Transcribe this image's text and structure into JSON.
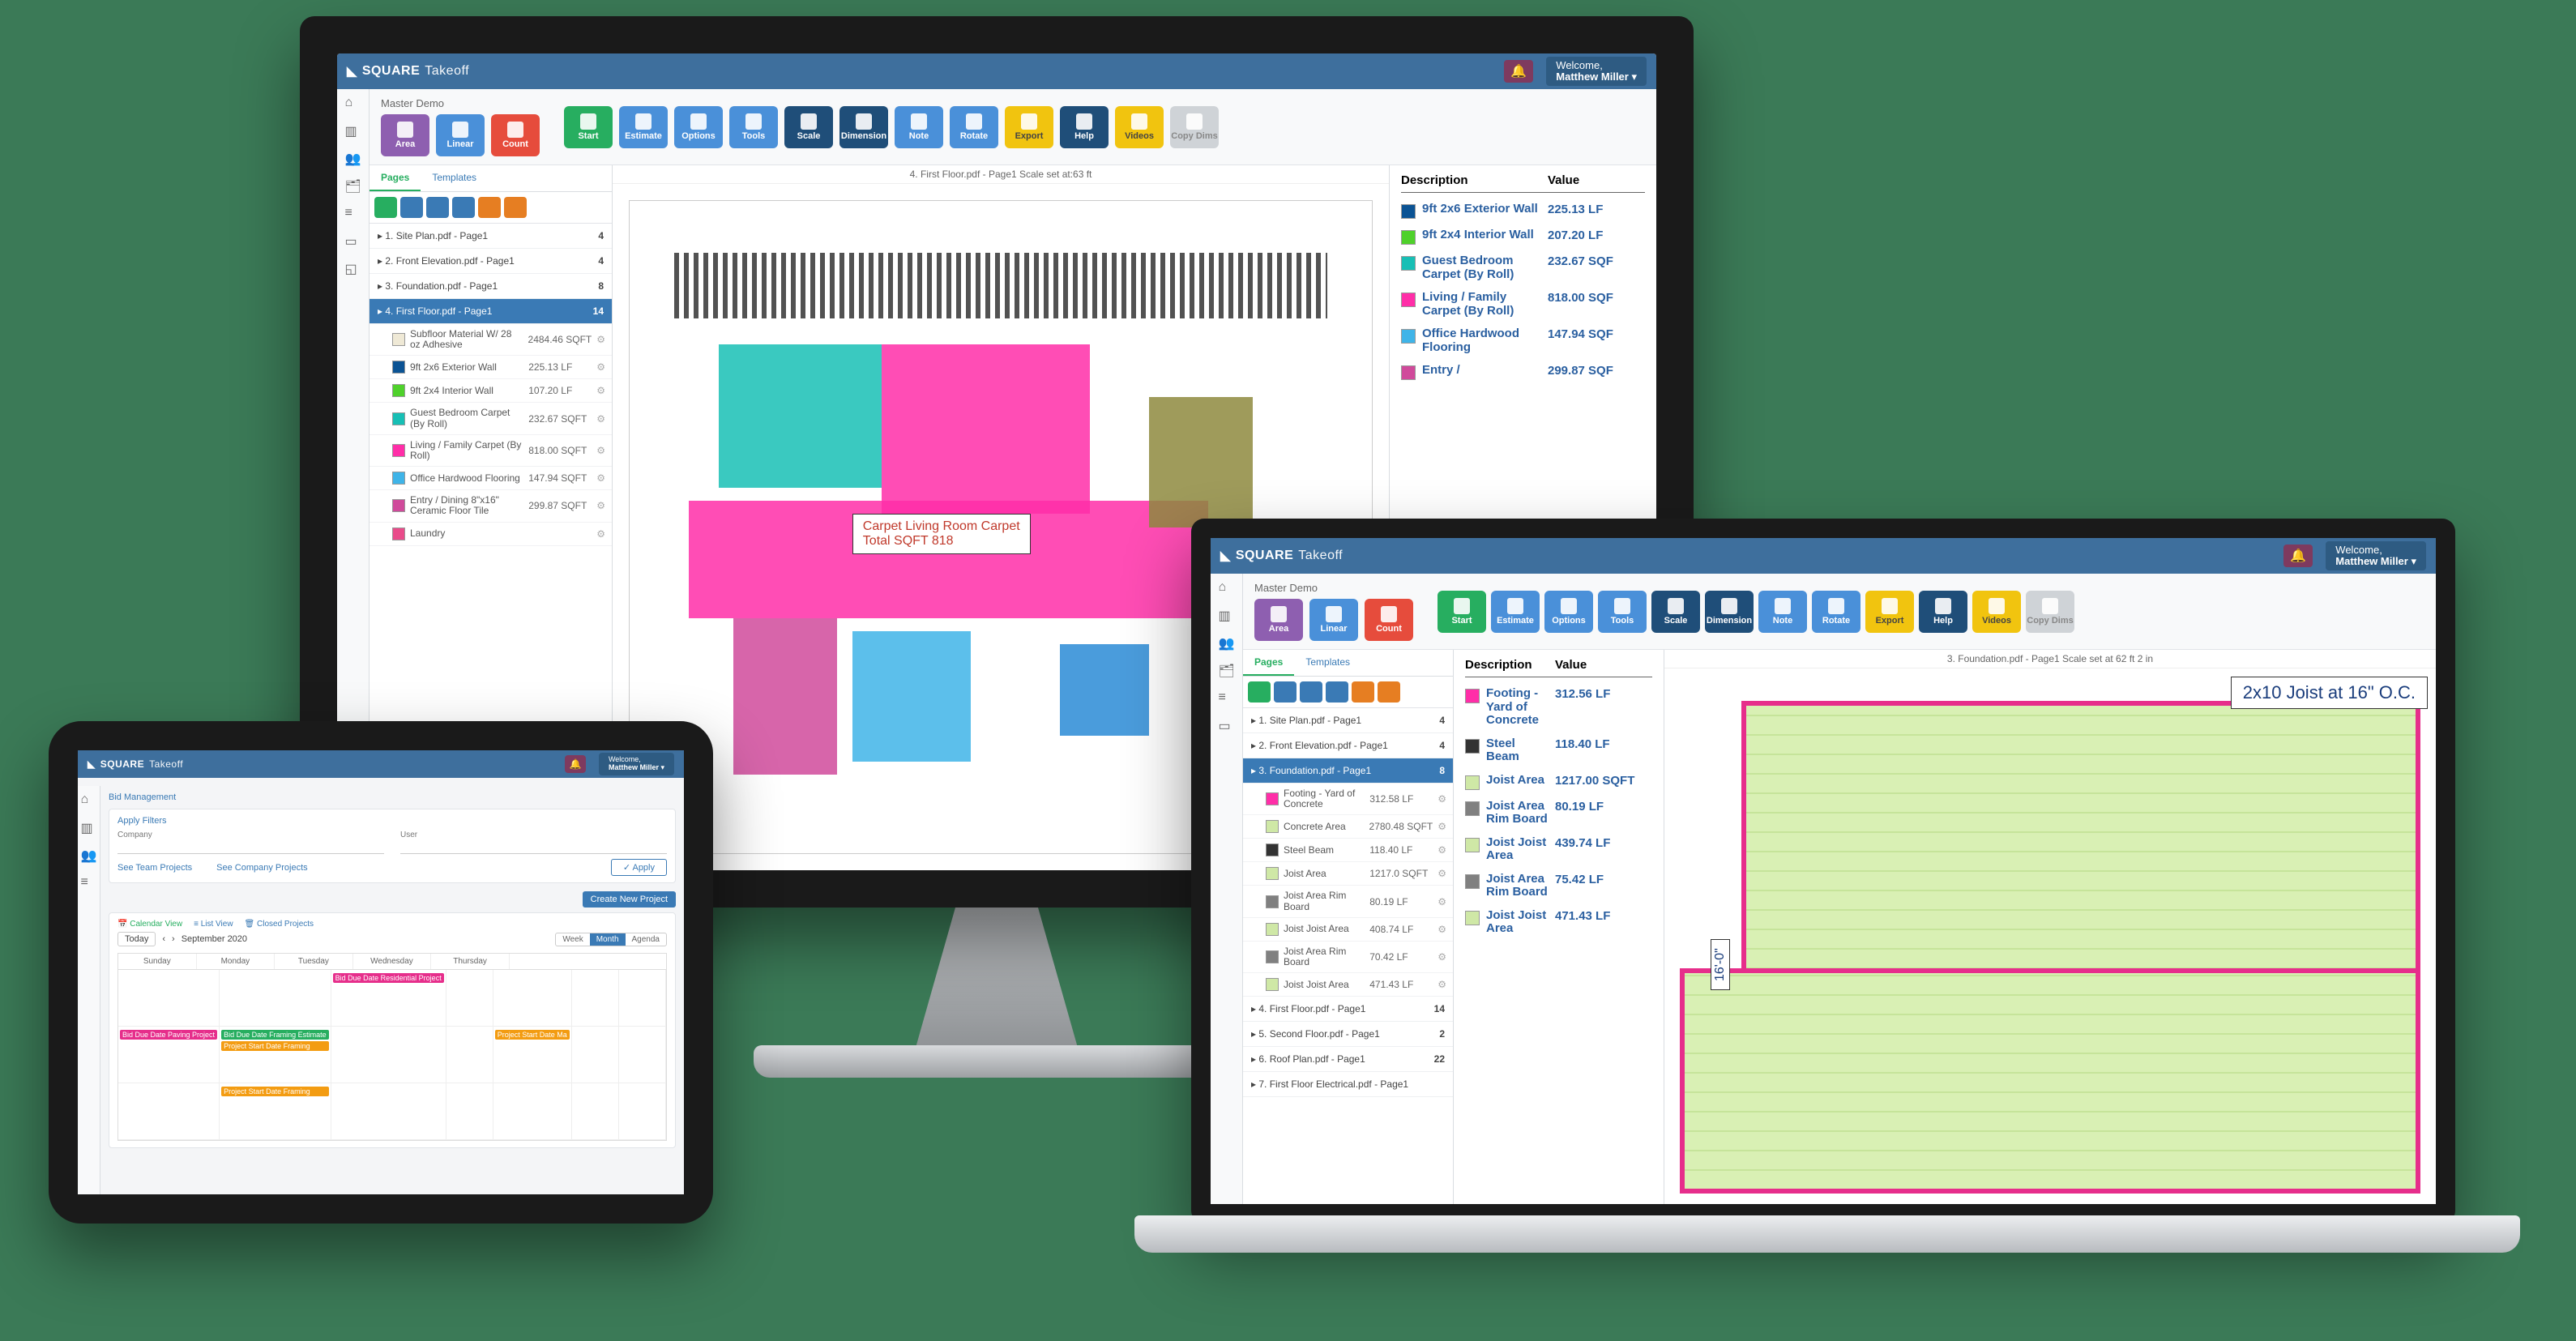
{
  "brand": {
    "bold": "SQUARE",
    "light": "Takeoff"
  },
  "welcome_label": "Welcome,",
  "welcome_user": "Matthew Miller",
  "monitor": {
    "project": "Master Demo",
    "mode_buttons": [
      {
        "label": "Area",
        "cls": "b-purple"
      },
      {
        "label": "Linear",
        "cls": "b-blue"
      },
      {
        "label": "Count",
        "cls": "b-red"
      }
    ],
    "action_buttons": [
      {
        "label": "Start",
        "cls": "b-green"
      },
      {
        "label": "Estimate",
        "cls": "b-blue"
      },
      {
        "label": "Options",
        "cls": "b-blue"
      },
      {
        "label": "Tools",
        "cls": "b-blue"
      },
      {
        "label": "Scale",
        "cls": "b-darkblue"
      },
      {
        "label": "Dimension",
        "cls": "b-darkblue"
      },
      {
        "label": "Note",
        "cls": "b-blue"
      },
      {
        "label": "Rotate",
        "cls": "b-blue"
      },
      {
        "label": "Export",
        "cls": "b-yellow"
      },
      {
        "label": "Help",
        "cls": "b-darkblue"
      },
      {
        "label": "Videos",
        "cls": "b-yellow"
      },
      {
        "label": "Copy Dims",
        "cls": "b-grey"
      }
    ],
    "tabs": {
      "pages": "Pages",
      "templates": "Templates"
    },
    "mini_colors": [
      "#27ae60",
      "#3a7ab5",
      "#3a7ab5",
      "#3a7ab5",
      "#e67e22",
      "#e67e22"
    ],
    "canvas_title": "4. First Floor.pdf - Page1 Scale set at:63 ft",
    "plan_label": "Carpet Living Room Carpet\nTotal SQFT 818",
    "pages": [
      {
        "name": "1. Site Plan.pdf - Page1",
        "count": "4"
      },
      {
        "name": "2. Front Elevation.pdf - Page1",
        "count": "4"
      },
      {
        "name": "3. Foundation.pdf - Page1",
        "count": "8"
      },
      {
        "name": "4. First Floor.pdf - Page1",
        "count": "14",
        "active": true
      }
    ],
    "items": [
      {
        "c": "#efe9d6",
        "n": "Subfloor Material W/ 28 oz Adhesive",
        "v": "2484.46 SQFT"
      },
      {
        "c": "#0b5394",
        "n": "9ft 2x6 Exterior Wall",
        "v": "225.13 LF"
      },
      {
        "c": "#4fd12b",
        "n": "9ft 2x4 Interior Wall",
        "v": "107.20 LF"
      },
      {
        "c": "#17bfb5",
        "n": "Guest Bedroom Carpet (By Roll)",
        "v": "232.67 SQFT"
      },
      {
        "c": "#ff2ea8",
        "n": "Living / Family Carpet (By Roll)",
        "v": "818.00 SQFT"
      },
      {
        "c": "#3fb4e8",
        "n": "Office Hardwood Flooring",
        "v": "147.94 SQFT"
      },
      {
        "c": "#d04a9b",
        "n": "Entry / Dining 8\"x16\" Ceramic Floor Tile",
        "v": "299.87 SQFT"
      },
      {
        "c": "#e94b8a",
        "n": "Laundry",
        "v": ""
      }
    ],
    "legend_header": {
      "d": "Description",
      "v": "Value"
    },
    "legend": [
      {
        "c": "#0b5394",
        "d": "9ft 2x6 Exterior Wall",
        "v": "225.13 LF"
      },
      {
        "c": "#4fd12b",
        "d": "9ft 2x4 Interior Wall",
        "v": "207.20 LF"
      },
      {
        "c": "#17bfb5",
        "d": "Guest Bedroom Carpet (By Roll)",
        "v": "232.67 SQF"
      },
      {
        "c": "#ff2ea8",
        "d": "Living / Family Carpet (By Roll)",
        "v": "818.00 SQF"
      },
      {
        "c": "#3fb4e8",
        "d": "Office Hardwood Flooring",
        "v": "147.94 SQF"
      },
      {
        "c": "#d04a9b",
        "d": "Entry /",
        "v": "299.87 SQF"
      }
    ]
  },
  "laptop": {
    "project": "Master Demo",
    "canvas_title": "3. Foundation.pdf - Page1 Scale set at 62 ft 2 in",
    "joist_label": "2x10 Joist at 16\" O.C.",
    "dim_v": "16'-0\"",
    "pages": [
      {
        "name": "1. Site Plan.pdf - Page1",
        "count": "4"
      },
      {
        "name": "2. Front Elevation.pdf - Page1",
        "count": "4"
      },
      {
        "name": "3. Foundation.pdf - Page1",
        "count": "8",
        "active": true
      }
    ],
    "pages_after": [
      {
        "name": "4. First Floor.pdf - Page1",
        "count": "14"
      },
      {
        "name": "5. Second Floor.pdf - Page1",
        "count": "2"
      },
      {
        "name": "6. Roof Plan.pdf - Page1",
        "count": "22"
      },
      {
        "name": "7. First Floor Electrical.pdf - Page1",
        "count": ""
      }
    ],
    "items": [
      {
        "c": "#ff2ea8",
        "n": "Footing - Yard of Concrete",
        "v": "312.58 LF"
      },
      {
        "c": "#cfe8a6",
        "n": "Concrete Area",
        "v": "2780.48 SQFT"
      },
      {
        "c": "#333333",
        "n": "Steel Beam",
        "v": "118.40 LF"
      },
      {
        "c": "#cfe8a6",
        "n": "Joist Area",
        "v": "1217.0 SQFT"
      },
      {
        "c": "#808080",
        "n": "Joist Area Rim Board",
        "v": "80.19 LF"
      },
      {
        "c": "#cfe8a6",
        "n": "Joist Joist Area",
        "v": "408.74 LF"
      },
      {
        "c": "#808080",
        "n": "Joist Area Rim Board",
        "v": "70.42 LF"
      },
      {
        "c": "#cfe8a6",
        "n": "Joist Joist Area",
        "v": "471.43 LF"
      }
    ],
    "legend": [
      {
        "c": "#ff2ea8",
        "d": "Footing - Yard of Concrete",
        "v": "312.56 LF"
      },
      {
        "c": "#333333",
        "d": "Steel Beam",
        "v": "118.40 LF"
      },
      {
        "c": "#cfe8a6",
        "d": "Joist Area",
        "v": "1217.00 SQFT"
      },
      {
        "c": "#808080",
        "d": "Joist Area Rim Board",
        "v": "80.19 LF"
      },
      {
        "c": "#cfe8a6",
        "d": "Joist Joist Area",
        "v": "439.74 LF"
      },
      {
        "c": "#808080",
        "d": "Joist Area Rim Board",
        "v": "75.42 LF"
      },
      {
        "c": "#cfe8a6",
        "d": "Joist Joist Area",
        "v": "471.43 LF"
      }
    ]
  },
  "tablet": {
    "breadcrumb": "Bid Management",
    "apply_filters": "Apply Filters",
    "company": "Company",
    "user": "User",
    "see_team": "See Team Projects",
    "see_company": "See Company Projects",
    "apply": "✓ Apply",
    "new_project": "Create New Project",
    "view_tabs": [
      "📅 Calendar View",
      "≡ List View",
      "🗑 Closed Projects"
    ],
    "today": "Today",
    "period": "September 2020",
    "seg": [
      "Week",
      "Month",
      "Agenda"
    ],
    "days": [
      "Sunday",
      "Monday",
      "Tuesday",
      "Wednesday",
      "Thursday"
    ],
    "events": [
      {
        "r": 0,
        "c": 2,
        "t": "Bid Due Date Residential Project",
        "bg": "#e62e8b"
      },
      {
        "r": 1,
        "c": 0,
        "t": "Bid Due Date Paving Project",
        "bg": "#e62e8b"
      },
      {
        "r": 1,
        "c": 1,
        "t": "Bid Due Date Framing Estimate",
        "bg": "#27ae60"
      },
      {
        "r": 1,
        "c": 1,
        "t": "Project Start Date Framing",
        "bg": "#f39c12"
      },
      {
        "r": 1,
        "c": 4,
        "t": "Project Start Date Ma",
        "bg": "#f39c12"
      },
      {
        "r": 2,
        "c": 1,
        "t": "Project Start Date Framing",
        "bg": "#f39c12"
      }
    ]
  }
}
